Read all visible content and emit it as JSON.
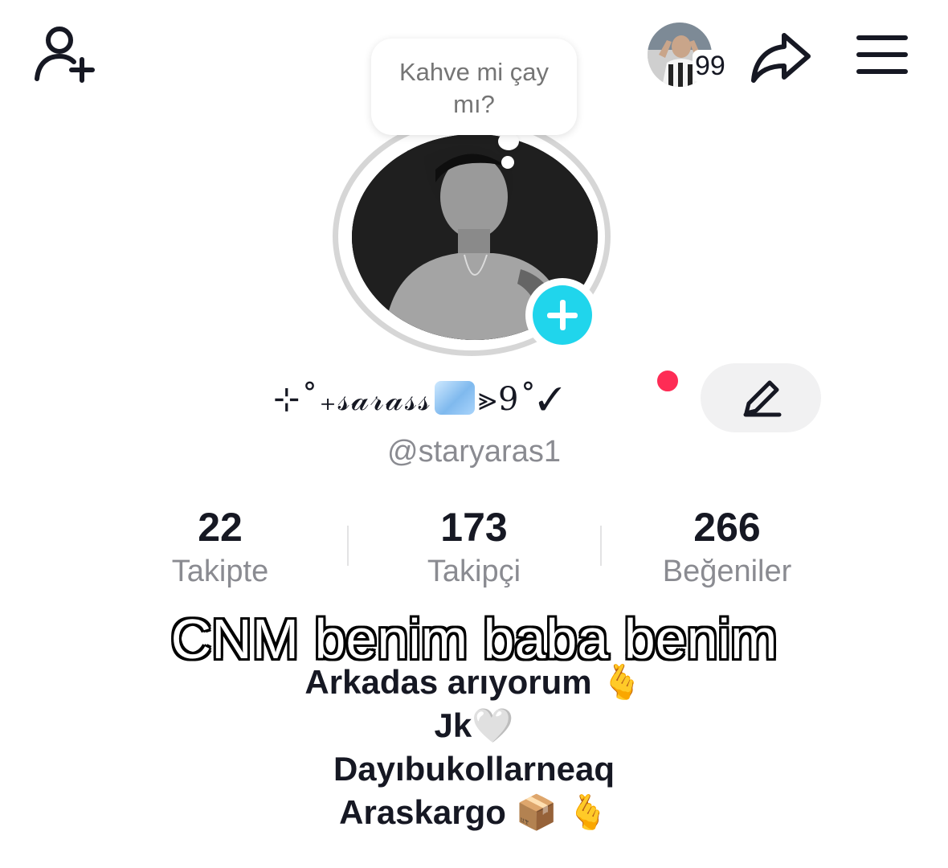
{
  "header": {
    "add_friend_icon": "person-plus-icon",
    "viewers_count": "99",
    "share_icon": "share-arrow-icon",
    "menu_icon": "hamburger-menu-icon"
  },
  "profile": {
    "note_text": "Kahve mi çay mı?",
    "display_name_prefix": "⊹˚₊𝓈𝒶𝓇𝒶𝓈𝓈",
    "display_name_suffix": "⪢9˚✓",
    "username": "@staryaras1",
    "add_story_icon": "plus-icon",
    "edit_icon": "pencil-icon"
  },
  "stats": {
    "following_count": "22",
    "following_label": "Takipte",
    "followers_count": "173",
    "followers_label": "Takipçi",
    "likes_count": "266",
    "likes_label": "Beğeniler"
  },
  "caption": "CNM benim baba benim",
  "bio": {
    "line1": "Arkadas arıyorum",
    "line1_emoji": "🫰",
    "line2": "Jk",
    "line2_emoji": "🤍",
    "line3": "Dayıbukollarneaq",
    "line4": "Araskargo",
    "line4_emoji1": "📦",
    "line4_emoji2": "🫰"
  },
  "colors": {
    "accent_cyan": "#20d5ec",
    "notification_red": "#fe2c55",
    "muted_text": "#8a8b91"
  }
}
